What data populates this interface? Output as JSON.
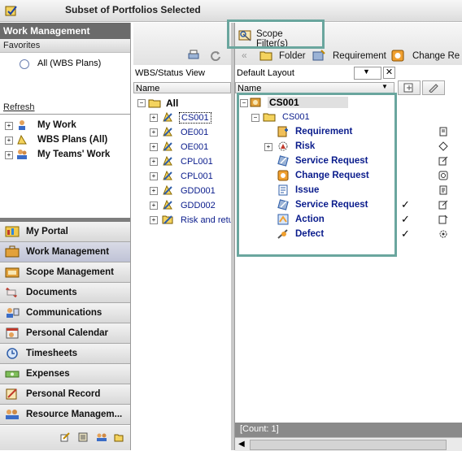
{
  "window": {
    "title": "Subset of Portfolios Selected"
  },
  "left": {
    "header": "Work Management",
    "favorites_label": "Favorites",
    "favorite_item": "All (WBS Plans)",
    "refresh_label": "Refresh",
    "tree": [
      "My Work",
      "WBS Plans (All)",
      "My Teams' Work"
    ],
    "nav": [
      "My Portal",
      "Work Management",
      "Scope Management",
      "Documents",
      "Communications",
      "Personal Calendar",
      "Timesheets",
      "Expenses",
      "Personal Record",
      "Resource Managem..."
    ]
  },
  "middle": {
    "view_label": "WBS/Status View",
    "name_col": "Name",
    "root": "All",
    "items": [
      "CS001",
      "OE001",
      "OE001",
      "CPL001",
      "CPL001",
      "GDD001",
      "GDD002",
      "Risk and retu"
    ]
  },
  "right": {
    "scope_filter": "Scope Filter(s)",
    "toolbar": {
      "folder": "Folder",
      "requirement": "Requirement",
      "change": "Change Re"
    },
    "layout": "Default Layout",
    "name_col": "Name",
    "root": "CS001",
    "folder": "CS001",
    "items": [
      "Requirement",
      "Risk",
      "Service Request",
      "Change Request",
      "Issue",
      "Service Request",
      "Action",
      "Defect"
    ],
    "count": "[Count: 1]"
  },
  "colors": {
    "accent_blue": "#0a1c8c",
    "highlight": "#6aa69e",
    "header_gray": "#6b6b6b"
  }
}
